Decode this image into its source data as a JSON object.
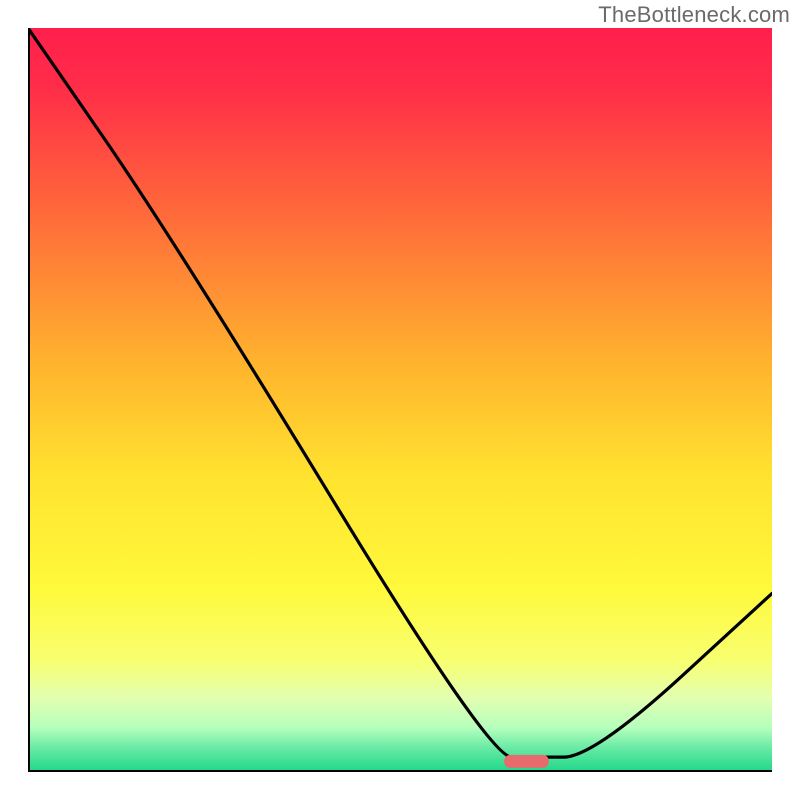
{
  "attribution": "TheBottleneck.com",
  "chart_data": {
    "type": "line",
    "title": "",
    "xlabel": "",
    "ylabel": "",
    "xlim": [
      0,
      100
    ],
    "ylim": [
      0,
      100
    ],
    "x": [
      0,
      20,
      62,
      68,
      76,
      100
    ],
    "values": [
      100,
      71,
      2,
      2,
      2,
      24
    ],
    "marker": {
      "x_start": 64,
      "x_end": 70,
      "y": 1.5
    },
    "background_gradient": {
      "stops": [
        {
          "offset": 0,
          "color": "#ff1f4b"
        },
        {
          "offset": 8,
          "color": "#ff2d49"
        },
        {
          "offset": 25,
          "color": "#ff6a3a"
        },
        {
          "offset": 45,
          "color": "#ffb32e"
        },
        {
          "offset": 60,
          "color": "#ffe22f"
        },
        {
          "offset": 75,
          "color": "#fff93a"
        },
        {
          "offset": 85,
          "color": "#f8ff70"
        },
        {
          "offset": 90,
          "color": "#e3ffb0"
        },
        {
          "offset": 94,
          "color": "#b6ffbd"
        },
        {
          "offset": 97,
          "color": "#62e9a3"
        },
        {
          "offset": 100,
          "color": "#1fd789"
        }
      ]
    },
    "marker_color": "#e96a6c",
    "curve_color": "#000000",
    "axis_color": "#000000"
  }
}
